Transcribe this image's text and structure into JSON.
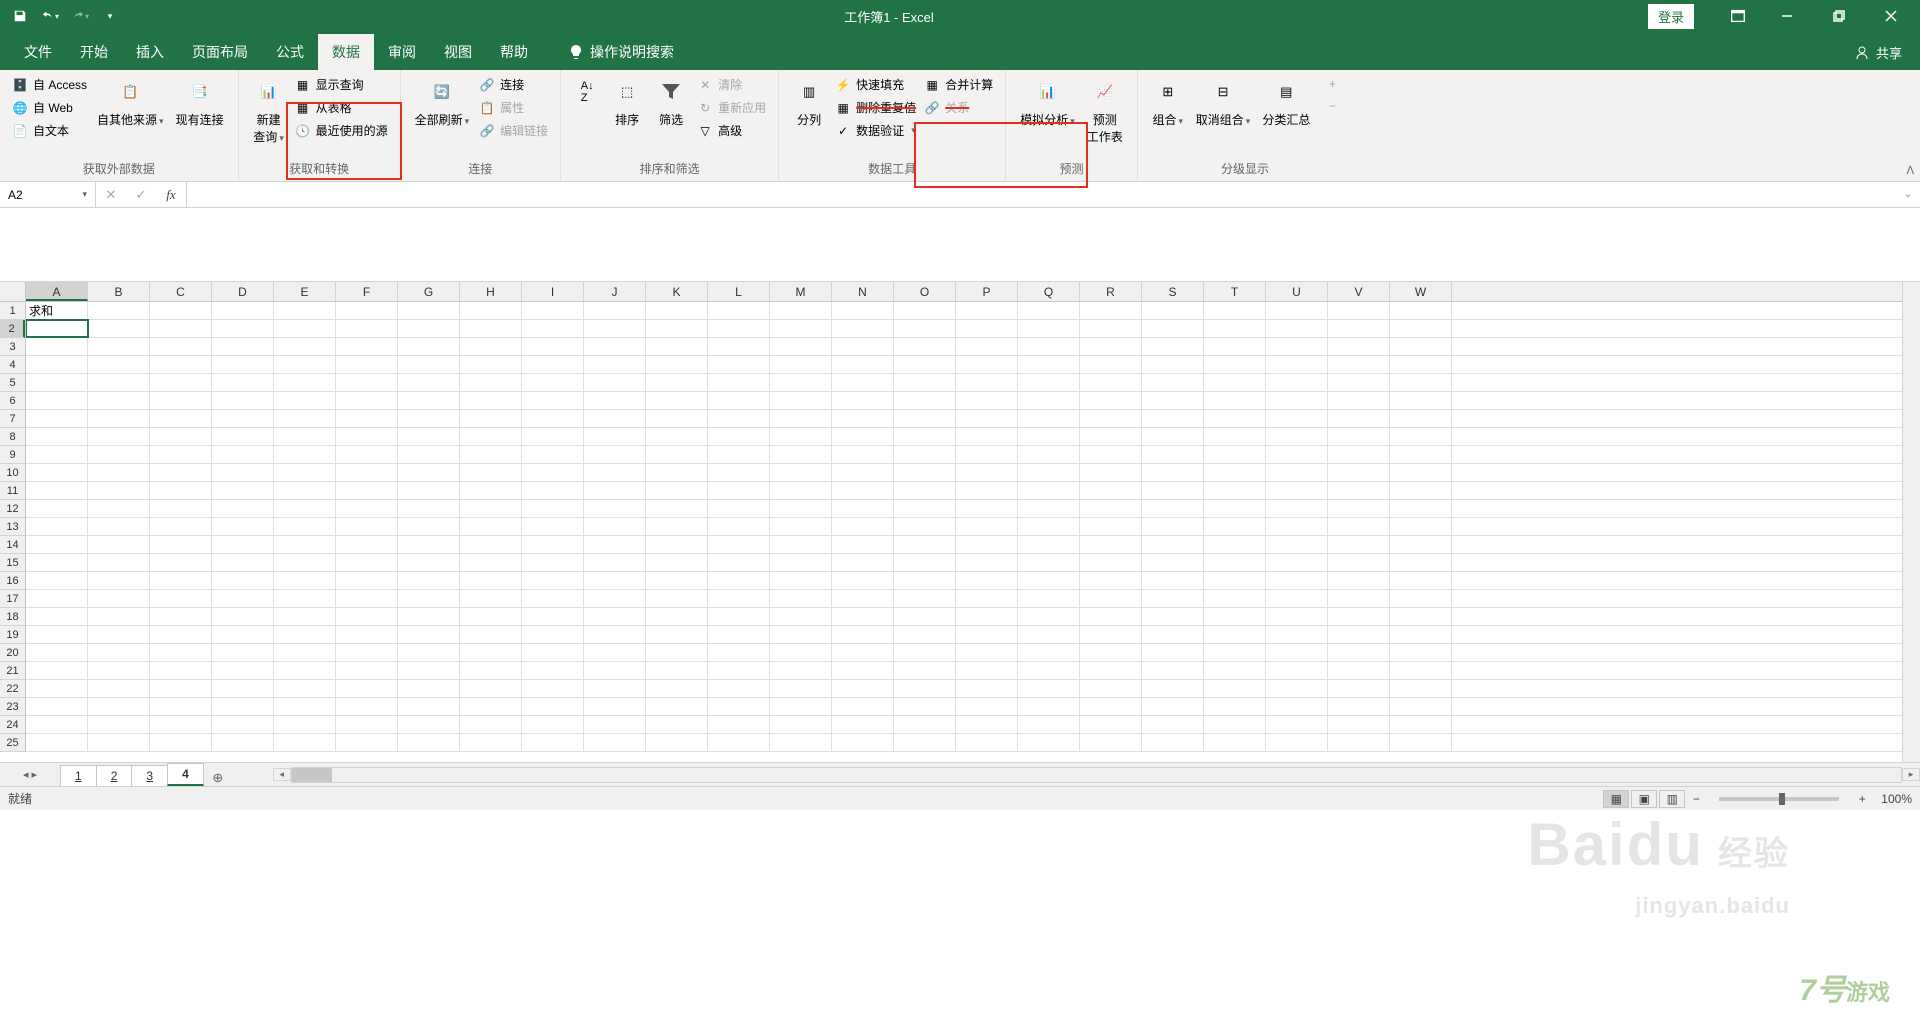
{
  "app": {
    "title": "工作簿1 - Excel",
    "login": "登录",
    "share": "共享",
    "tellMe": "操作说明搜索"
  },
  "tabs": {
    "file": "文件",
    "home": "开始",
    "insert": "插入",
    "pageLayout": "页面布局",
    "formulas": "公式",
    "data": "数据",
    "review": "审阅",
    "view": "视图",
    "help": "帮助"
  },
  "ribbon": {
    "extData": {
      "access": "自 Access",
      "web": "自 Web",
      "text": "自文本",
      "other": "自其他来源",
      "existing": "现有连接",
      "label": "获取外部数据"
    },
    "getTransform": {
      "newQuery": "新建\n查询",
      "showQueries": "显示查询",
      "fromTable": "从表格",
      "recent": "最近使用的源",
      "label": "获取和转换"
    },
    "connections": {
      "refreshAll": "全部刷新",
      "connections": "连接",
      "properties": "属性",
      "editLinks": "编辑链接",
      "label": "连接"
    },
    "sortFilter": {
      "sort": "排序",
      "filter": "筛选",
      "clear": "清除",
      "reapply": "重新应用",
      "advanced": "高级",
      "label": "排序和筛选"
    },
    "dataTools": {
      "textToCol": "分列",
      "flashFill": "快速填充",
      "removeDup": "删除重复值",
      "consolidate": "合并计算",
      "relationships": "关系",
      "dataValidation": "数据验证",
      "label": "数据工具"
    },
    "forecast": {
      "whatIf": "模拟分析",
      "forecast": "预测\n工作表",
      "label": "预测"
    },
    "outline": {
      "group": "组合",
      "ungroup": "取消组合",
      "subtotal": "分类汇总",
      "label": "分级显示"
    }
  },
  "namebox": "A2",
  "cells": {
    "A1": "求和"
  },
  "columns": [
    "A",
    "B",
    "C",
    "D",
    "E",
    "F",
    "G",
    "H",
    "I",
    "J",
    "K",
    "L",
    "M",
    "N",
    "O",
    "P",
    "Q",
    "R",
    "S",
    "T",
    "U",
    "V",
    "W"
  ],
  "rowCount": 25,
  "sheets": {
    "s1": "1",
    "s2": "2",
    "s3": "3",
    "s4": "4"
  },
  "status": {
    "ready": "就绪",
    "zoom": "100%"
  },
  "watermark": {
    "brand": "Baidu",
    "suffix": "经验",
    "url": "jingyan.baidu",
    "corner": "7号",
    "cornerSuffix": "游戏"
  }
}
